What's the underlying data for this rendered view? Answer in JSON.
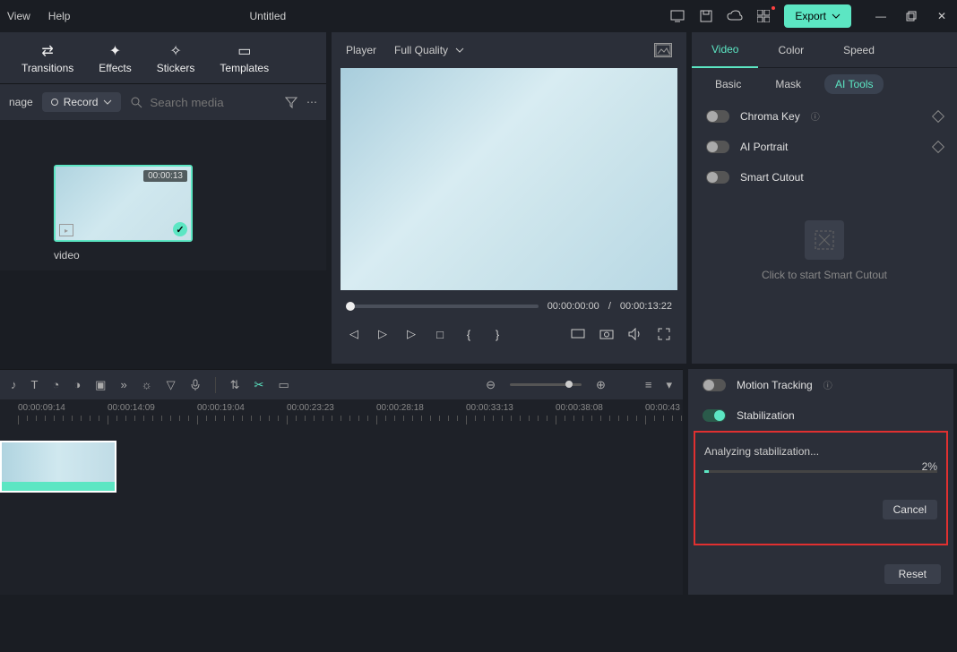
{
  "menu": {
    "view": "View",
    "help": "Help"
  },
  "title": "Untitled",
  "export_label": "Export",
  "toolbar": {
    "transitions": "Transitions",
    "effects": "Effects",
    "stickers": "Stickers",
    "templates": "Templates"
  },
  "filterbar": {
    "nage": "nage",
    "record": "Record",
    "search_placeholder": "Search media"
  },
  "clip": {
    "duration": "00:00:13",
    "label": "video"
  },
  "player": {
    "label": "Player",
    "quality": "Full Quality",
    "current": "00:00:00:00",
    "total": "00:00:13:22",
    "sep": "/"
  },
  "props": {
    "tabs": {
      "video": "Video",
      "color": "Color",
      "speed": "Speed"
    },
    "subtabs": {
      "basic": "Basic",
      "mask": "Mask",
      "aitools": "AI Tools"
    },
    "chroma": "Chroma Key",
    "aiportrait": "AI Portrait",
    "smartcutout": "Smart Cutout",
    "smartcutout_hint": "Click to start Smart Cutout",
    "motiontracking": "Motion Tracking",
    "stabilization": "Stabilization"
  },
  "stab": {
    "msg": "Analyzing stabilization...",
    "pct": "2%",
    "cancel": "Cancel"
  },
  "reset": "Reset",
  "ruler": [
    "00:00:09:14",
    "00:00:14:09",
    "00:00:19:04",
    "00:00:23:23",
    "00:00:28:18",
    "00:00:33:13",
    "00:00:38:08",
    "00:00:43"
  ]
}
